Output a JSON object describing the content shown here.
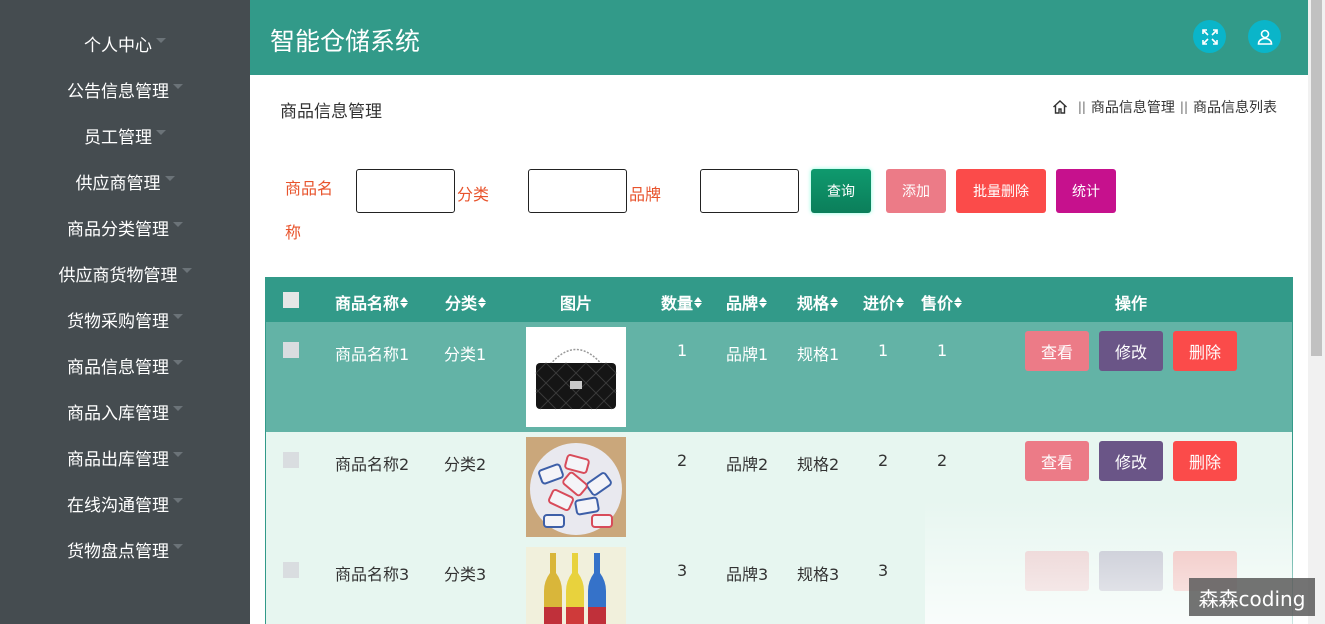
{
  "app": {
    "title": "智能仓储系统"
  },
  "sidebar": {
    "items": [
      {
        "label": "个人中心"
      },
      {
        "label": "公告信息管理"
      },
      {
        "label": "员工管理"
      },
      {
        "label": "供应商管理"
      },
      {
        "label": "商品分类管理"
      },
      {
        "label": "供应商货物管理"
      },
      {
        "label": "货物采购管理"
      },
      {
        "label": "商品信息管理"
      },
      {
        "label": "商品入库管理"
      },
      {
        "label": "商品出库管理"
      },
      {
        "label": "在线沟通管理"
      },
      {
        "label": "货物盘点管理"
      }
    ]
  },
  "header": {
    "fullscreen_icon": "expand-icon",
    "user_icon": "user-icon"
  },
  "page": {
    "title": "商品信息管理"
  },
  "breadcrumb": {
    "home_icon": "home-icon",
    "sep": "||",
    "items": [
      "商品信息管理",
      "商品信息列表"
    ]
  },
  "search": {
    "name_label": "商品名称",
    "category_label": "分类",
    "brand_label": "品牌",
    "name_value": "",
    "category_value": "",
    "brand_value": "",
    "query_btn": "查询",
    "add_btn": "添加",
    "batch_delete_btn": "批量删除",
    "stats_btn": "统计"
  },
  "table": {
    "headers": {
      "name": "商品名称",
      "category": "分类",
      "image": "图片",
      "quantity": "数量",
      "brand": "品牌",
      "spec": "规格",
      "purchase_price": "进价",
      "sale_price": "售价",
      "actions": "操作"
    },
    "rows": [
      {
        "name": "商品名称1",
        "category": "分类1",
        "quantity": "1",
        "brand": "品牌1",
        "spec": "规格1",
        "purchase_price": "1",
        "sale_price": "1"
      },
      {
        "name": "商品名称2",
        "category": "分类2",
        "quantity": "2",
        "brand": "品牌2",
        "spec": "规格2",
        "purchase_price": "2",
        "sale_price": "2"
      },
      {
        "name": "商品名称3",
        "category": "分类3",
        "quantity": "3",
        "brand": "品牌3",
        "spec": "规格3",
        "purchase_price": "3",
        "sale_price": ""
      }
    ],
    "row_actions": {
      "view": "查看",
      "edit": "修改",
      "delete": "删除"
    }
  },
  "watermark": "森森coding",
  "colors": {
    "primary": "#329a89",
    "sidebar": "#454c50",
    "accent_label": "#e8542d"
  }
}
